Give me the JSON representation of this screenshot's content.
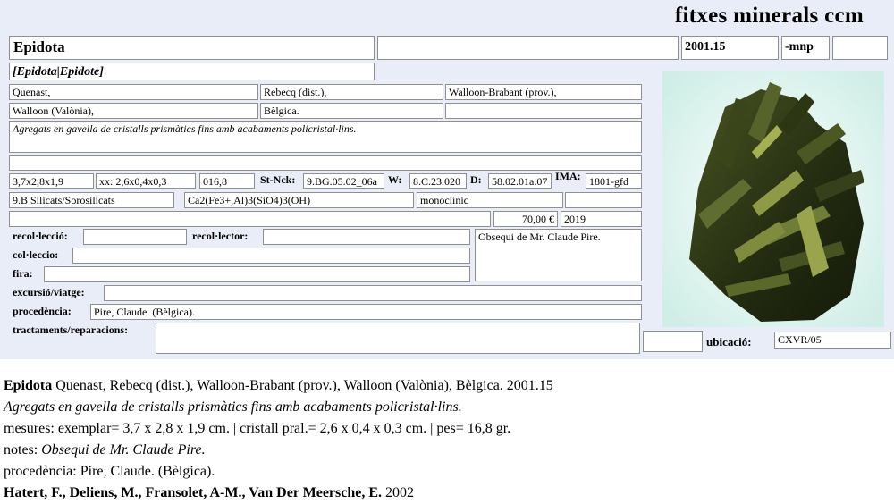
{
  "header": {
    "brand": "fitxes minerals ccm"
  },
  "card": {
    "name": "Epidota",
    "name_blank": "",
    "code": "2001.15",
    "suffix": "-mnp",
    "suffix_blank": "",
    "synonyms": "[Epidota|Epidote]",
    "locality": [
      "Quenast,",
      "Rebecq (dist.),",
      "Walloon-Brabant (prov.),",
      "Walloon (Valònia),",
      "Bèlgica.",
      ""
    ],
    "description": "Agregats en gavella de cristalls prismàtics fins amb acabaments policristal·lins.",
    "line_blank": "",
    "measures": "3,7x2,8x1,9",
    "crystal": "xx: 2,6x0,4x0,3",
    "weight": "016,8",
    "strunz_label": "St-Nck:",
    "strunz": "9.BG.05.02_06a",
    "w_label": "W:",
    "w": "8.C.23.020",
    "d_label": "D:",
    "d": "58.02.01a.07",
    "ima_label": "IMA:",
    "ima": "1801-gfd",
    "class": "9.B Silicats/Sorosilicats",
    "formula": "Ca2(Fe3+,Al)3(SiO4)3(OH)",
    "system": "monoclínic",
    "system_blank": "",
    "price_blank": "",
    "price": "70,00 €",
    "year": "2019",
    "recol_label": "recol·lecció:",
    "recol": "",
    "recollector_label": "recol·lector:",
    "recollector": "",
    "notes": "Obsequi de Mr. Claude Pire.",
    "coleccio_label": "col·leccio:",
    "coleccio": "",
    "fira_label": "fira:",
    "fira": "",
    "excursio_label": "excursió/viatge:",
    "excursio": "",
    "procedencia_label": "procedència:",
    "procedencia": "Pire, Claude. (Bèlgica).",
    "tractaments_label": "tractaments/reparacions:",
    "tractaments": "",
    "loc_blank": "",
    "ubicacio_label": "ubicació:",
    "ubicacio": "CXVR/05"
  },
  "summary": {
    "line1_name": "Epidota",
    "line1_rest": " Quenast, Rebecq (dist.), Walloon-Brabant (prov.), Walloon (Valònia), Bèlgica.  2001.15",
    "line2": "Agregats en gavella de cristalls prismàtics fins amb acabaments policristal·lins.",
    "line3": "mesures: exemplar= 3,7 x 2,8 x 1,9 cm. | cristall pral.= 2,6 x 0,4 x 0,3 cm. | pes= 16,8 gr.",
    "line4_label": "notes: ",
    "line4_value": "Obsequi de Mr. Claude Pire.",
    "line5": "procedència: Pire, Claude. (Bèlgica).",
    "line6_authors": "Hatert, F., Deliens, M., Fransolet, A-M., Van Der Meersche, E.",
    "line6_year": " 2002"
  },
  "photo": {
    "icon": "mineral-specimen-photo",
    "colors": {
      "background": "#eaf6f3",
      "crystal": "#2f3a18",
      "highlight": "#8e9a45"
    }
  }
}
